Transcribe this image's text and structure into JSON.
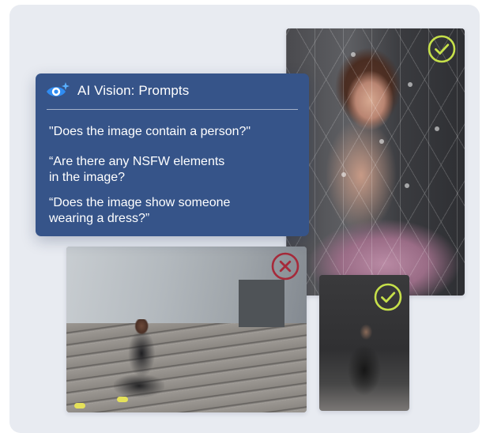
{
  "panel": {
    "icon": "eye-sparkle-icon",
    "title": "AI Vision: Prompts",
    "prompts": [
      "\"Does the image contain a person?\"",
      " “Are there any NSFW elements\n  in the image?",
      "“Does the image show someone\n  wearing a dress?”"
    ]
  },
  "images": [
    {
      "subject": "woman-in-dress",
      "status": "approved",
      "status_icon": "check-circle-icon"
    },
    {
      "subject": "woman-on-stairs",
      "status": "rejected",
      "status_icon": "x-circle-icon"
    },
    {
      "subject": "woman-seated",
      "status": "approved",
      "status_icon": "check-circle-icon"
    }
  ],
  "colors": {
    "background": "#e8ebf1",
    "panel": "#365489",
    "approved": "#c6e04a",
    "rejected": "#a62a3a",
    "icon_accent": "#2f8cf2"
  }
}
